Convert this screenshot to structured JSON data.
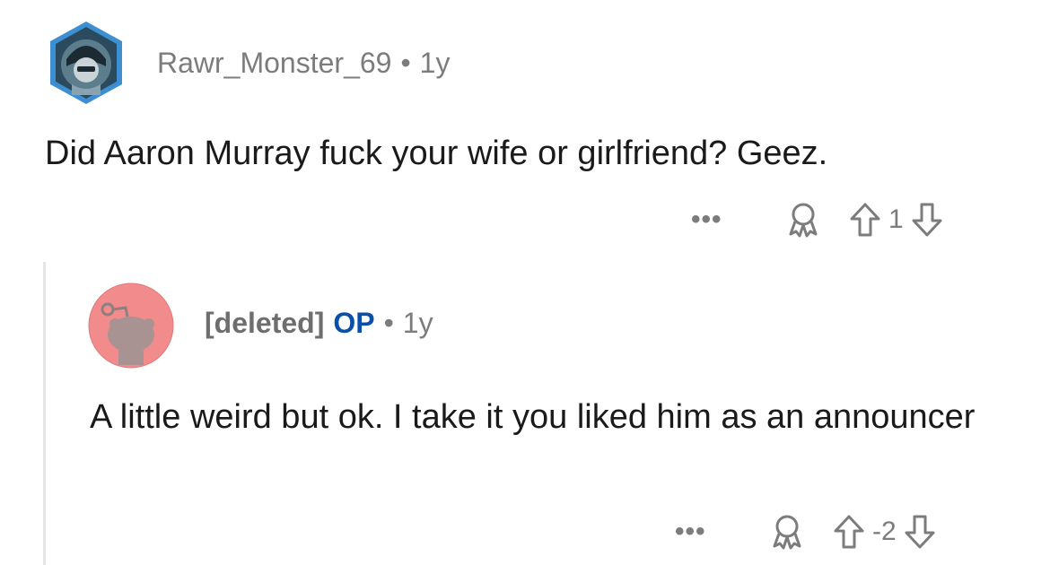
{
  "comment1": {
    "username": "Rawr_Monster_69",
    "separator": "•",
    "age": "1y",
    "text": "Did Aaron Murray fuck your wife or girlfriend? Geez.",
    "more": "•••",
    "score": "1",
    "avatar_icon": "snoo-avatar-hooded",
    "award_icon": "award-icon",
    "upvote_icon": "upvote-arrow-icon",
    "downvote_icon": "downvote-arrow-icon"
  },
  "comment2": {
    "username": "[deleted]",
    "op_badge": "OP",
    "separator": "•",
    "age": "1y",
    "text": "A little weird but ok. I take it you liked him as an announcer",
    "more": "•••",
    "score": "-2",
    "avatar_icon": "deleted-user-snoo-avatar",
    "award_icon": "award-icon",
    "upvote_icon": "upvote-arrow-icon",
    "downvote_icon": "downvote-arrow-icon"
  },
  "colors": {
    "meta_gray": "#7c7c7c",
    "op_blue": "#0a4fa8",
    "text": "#1a1a1b",
    "thread_line": "#e5e5e5",
    "avatar2_bg": "#f28b8b"
  }
}
